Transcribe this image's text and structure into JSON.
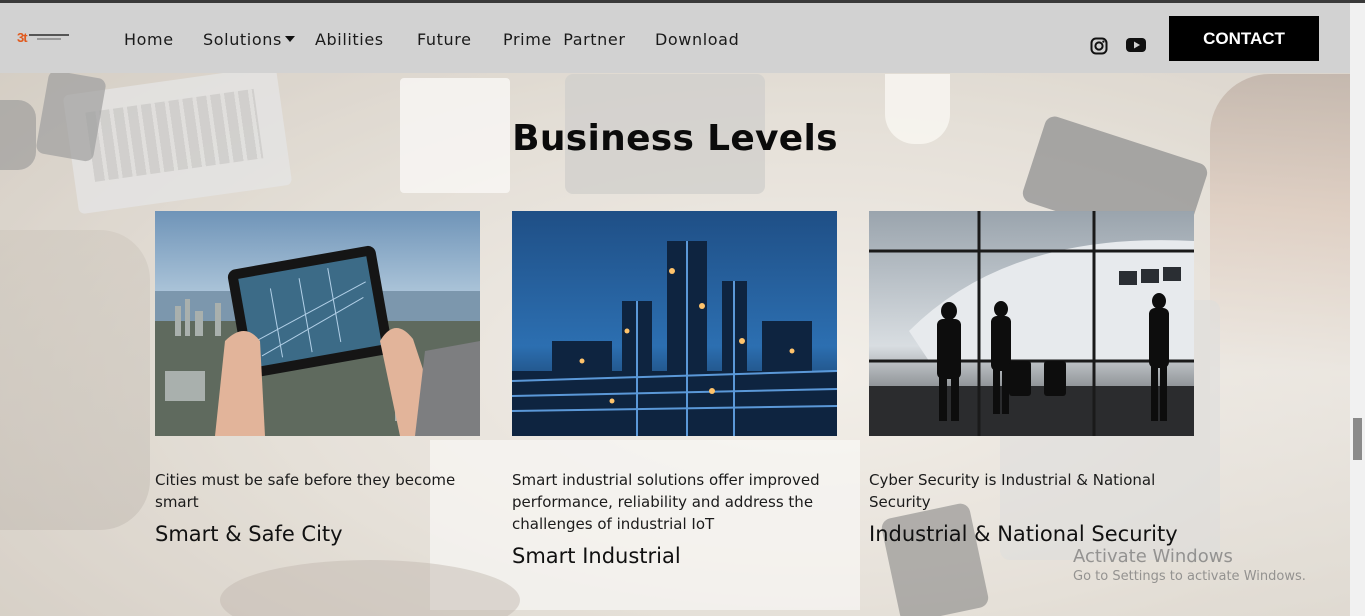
{
  "nav": {
    "items": [
      "Home",
      "Solutions",
      "Abilities",
      "Future",
      "Prime  Partner",
      "Download"
    ],
    "contact_label": "CONTACT"
  },
  "social": [
    "instagram-icon",
    "youtube-icon"
  ],
  "section": {
    "title": "Business Levels",
    "cards": [
      {
        "desc": "Cities must be safe before they become smart",
        "title": "Smart & Safe City",
        "image": "city-tablet-image"
      },
      {
        "desc": "Smart industrial solutions offer improved performance, reliability and address the challenges of industrial IoT",
        "title": "Smart Industrial",
        "image": "refinery-night-image"
      },
      {
        "desc": "Cyber Security is Industrial & National Security",
        "title": "Industrial & National Security",
        "image": "airport-silhouette-image"
      }
    ]
  },
  "watermark": {
    "line1": "Activate Windows",
    "line2": "Go to Settings to activate Windows."
  },
  "colors": {
    "header_bg": "#d2d2d2",
    "contact_bg": "#000000",
    "logo_accent": "#e15a1e"
  }
}
